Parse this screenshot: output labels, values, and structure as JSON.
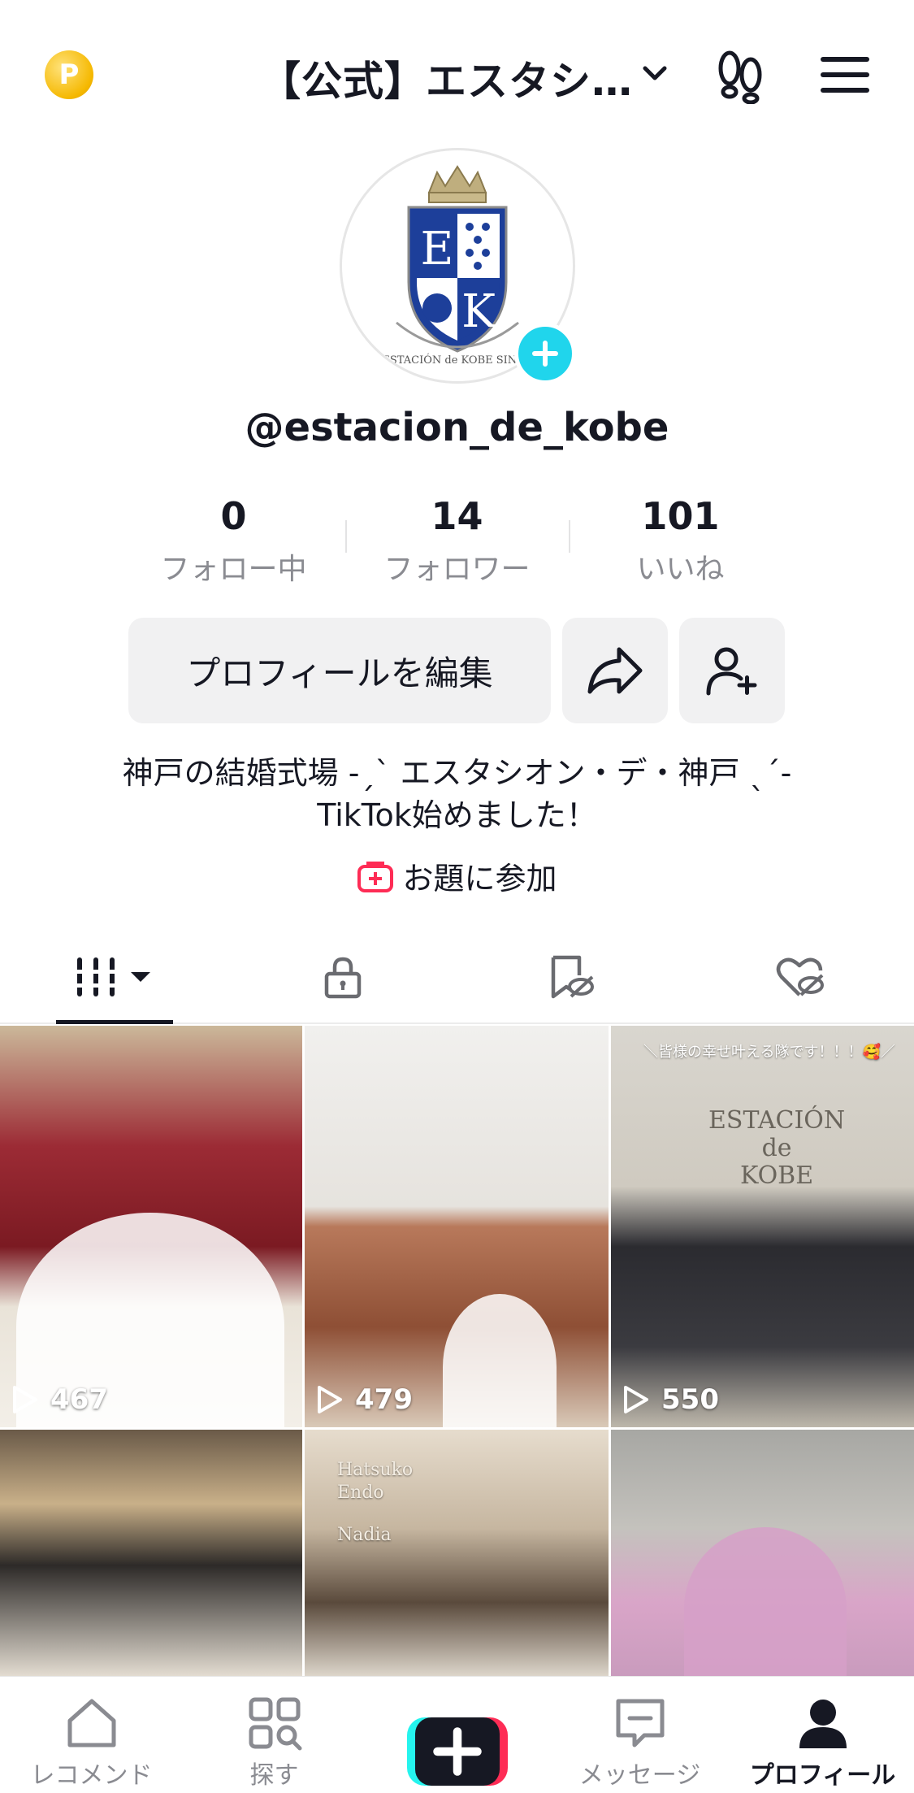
{
  "header": {
    "account_title": "【公式】エスタシ…",
    "coin_glyph": "P"
  },
  "profile": {
    "handle": "@estacion_de_kobe",
    "logo_letters": [
      "E",
      "K"
    ],
    "logo_ribbon": "ESTACIÓN de KOBE SINCE"
  },
  "stats": [
    {
      "value": "0",
      "label": "フォロー中"
    },
    {
      "value": "14",
      "label": "フォロワー"
    },
    {
      "value": "101",
      "label": "いいね"
    }
  ],
  "actions": {
    "edit_label": "プロフィールを編集"
  },
  "bio": {
    "line1": "神戸の結婚式場 -ˏˋ エスタシオン・デ・神戸 ˎˊ-",
    "line2": "TikTok始めました！"
  },
  "topic": {
    "label": "お題に参加"
  },
  "videos": [
    {
      "views": "467"
    },
    {
      "views": "479"
    },
    {
      "views": "550",
      "caption": "＼皆様の幸せ叶える隊です！！！🥰／",
      "sign": [
        "ESTACIÓN",
        "de",
        "KOBE"
      ]
    },
    {},
    {
      "overlay": [
        "Hatsuko",
        "Endo",
        "",
        "Nadia"
      ]
    },
    {}
  ],
  "bottom_nav": [
    {
      "label": "レコメンド",
      "icon": "home-icon"
    },
    {
      "label": "探す",
      "icon": "discover-icon"
    },
    {
      "label": "",
      "icon": "create-icon"
    },
    {
      "label": "メッセージ",
      "icon": "inbox-icon"
    },
    {
      "label": "プロフィール",
      "icon": "profile-icon"
    }
  ],
  "colors": {
    "accent_cyan": "#20d5ec",
    "brand_red": "#fe2c55",
    "brand_cyan": "#25f4ee",
    "text": "#161823",
    "muted": "#8a8b91"
  }
}
